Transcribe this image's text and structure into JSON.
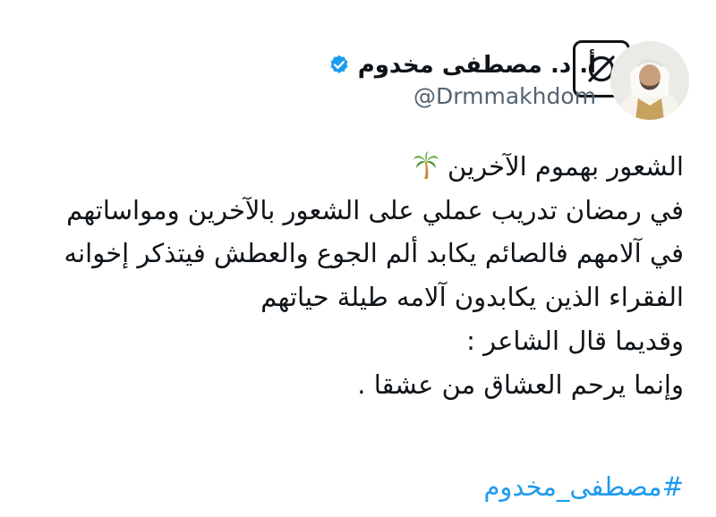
{
  "post": {
    "author": {
      "display_name": "أ. د. مصطفى مخدوم",
      "handle": "@Drmmakhdom",
      "verified": true,
      "verified_color": "#1d9bf0"
    },
    "body_lines": [
      "الشعور بهموم الآخرين",
      "في رمضان تدريب عملي على الشعور بالآخرين ومواساتهم",
      "في آلامهم فالصائم يكابد ألم الجوع والعطش فيتذكر إخوانه",
      "الفقراء الذين يكابدون آلامه طيلة حياتهم",
      "وقديما قال الشاعر :",
      "وإنما يرحم العشاق من عشقا ."
    ],
    "title_emoji_icon": "palm-tree-icon",
    "hashtag": "#مصطفى_مخدوم",
    "hashtag_color": "#1d9bf0",
    "text_color": "#0f1419",
    "secondary_text_color": "#536471"
  }
}
